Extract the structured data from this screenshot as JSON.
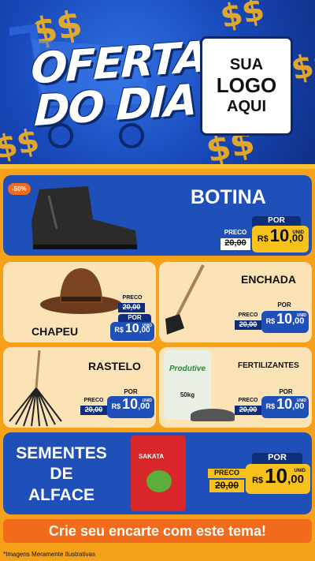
{
  "header": {
    "title_line1": "OFERTA",
    "title_line2": "DO DIA",
    "logo_line1": "SUA",
    "logo_line2": "LOGO",
    "logo_line3": "AQUI",
    "dollar_glyph": "$$"
  },
  "products": [
    {
      "name": "BOTINA",
      "discount": "-50%",
      "por_label": "POR",
      "preco_label": "PRECO",
      "old_price": "20,00",
      "currency": "R$",
      "price_int": "10",
      "price_dec": ",00",
      "unit": "UNID"
    },
    {
      "name": "CHAPEU",
      "por_label": "POR",
      "preco_label": "PRECO",
      "old_price": "20,00",
      "currency": "R$",
      "price_int": "10",
      "price_dec": ",00",
      "unit": "UNID"
    },
    {
      "name": "ENCHADA",
      "por_label": "POR",
      "preco_label": "PRECO",
      "old_price": "20,00",
      "currency": "R$",
      "price_int": "10",
      "price_dec": ",00",
      "unit": "UNID"
    },
    {
      "name": "RASTELO",
      "por_label": "POR",
      "preco_label": "PRECO",
      "old_price": "20,00",
      "currency": "R$",
      "price_int": "10",
      "price_dec": ",00",
      "unit": "UNID"
    },
    {
      "name": "FERTILIZANTES",
      "bag_brand": "Produtive",
      "bag_weight": "50kg",
      "por_label": "POR",
      "preco_label": "PRECO",
      "old_price": "20,00",
      "currency": "R$",
      "price_int": "10",
      "price_dec": ",00",
      "unit": "UNID"
    },
    {
      "name_line1": "SEMENTES",
      "name_line2": "DE",
      "name_line3": "ALFACE",
      "pack_brand": "SAKATA",
      "por_label": "POR",
      "preco_label": "PRECO",
      "old_price": "20,00",
      "currency": "R$",
      "price_int": "10",
      "price_dec": ",00",
      "unit": "UNID"
    }
  ],
  "cta": "Crie seu encarte com este tema!",
  "footer": "*Imagens Meramente Ilustrativas",
  "colors": {
    "blue": "#1f4fb8",
    "navy": "#0e2e7c",
    "yellow": "#f8c21c",
    "orange": "#f26a1b",
    "cream": "#fbe3b5"
  }
}
